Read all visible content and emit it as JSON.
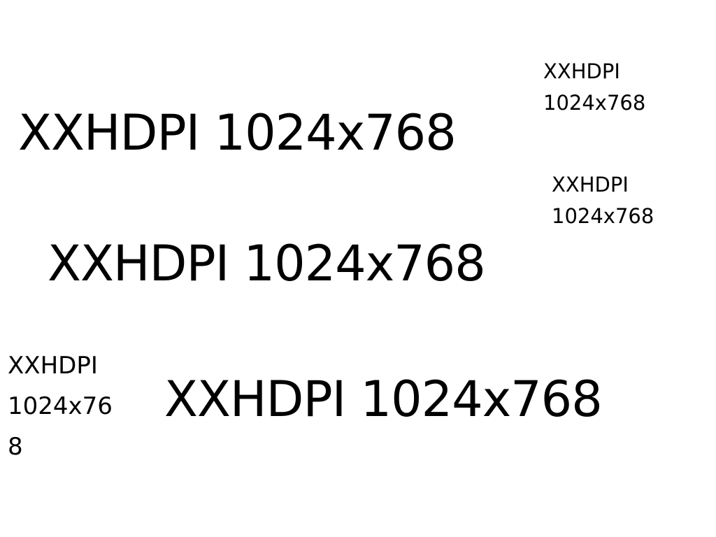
{
  "background": "#ffffff",
  "text_color": "#000000",
  "labels": {
    "large_1": "XXHDPI 1024x768",
    "large_2": "XXHDPI 1024x768",
    "large_3": "XXHDPI 1024x768",
    "small_1": "XXHDPI\n1024x768",
    "small_2": "XXHDPI\n1024x768",
    "medium_1": "XXHDPI\n1024x76\n8"
  }
}
